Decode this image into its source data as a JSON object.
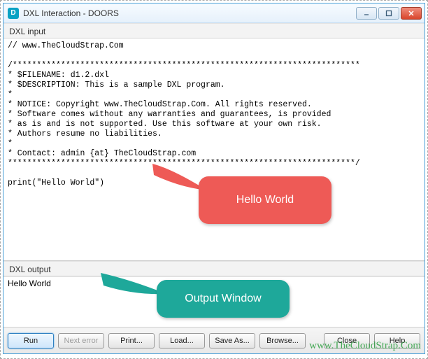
{
  "titlebar": {
    "title": "DXL Interaction - DOORS"
  },
  "labels": {
    "input": "DXL input",
    "output": "DXL output"
  },
  "code": "// www.TheCloudStrap.Com\n\n/************************************************************************\n* $FILENAME: d1.2.dxl\n* $DESCRIPTION: This is a sample DXL program.\n*\n* NOTICE: Copyright www.TheCloudStrap.Com. All rights reserved.\n* Software comes without any warranties and guarantees, is provided\n* as is and is not supported. Use this software at your own risk.\n* Authors resume no liabilities.\n*\n* Contact: admin {at} TheCloudStrap.com\n************************************************************************/\n\nprint(\"Hello World\")",
  "output": "Hello World",
  "callouts": {
    "red": "Hello World",
    "green": "Output Window"
  },
  "buttons": {
    "run": "Run",
    "next_error": "Next error",
    "print": "Print...",
    "load": "Load...",
    "save_as": "Save As...",
    "browse": "Browse...",
    "close": "Close",
    "help": "Help"
  },
  "watermark": "www.TheCloudStrap.Com"
}
